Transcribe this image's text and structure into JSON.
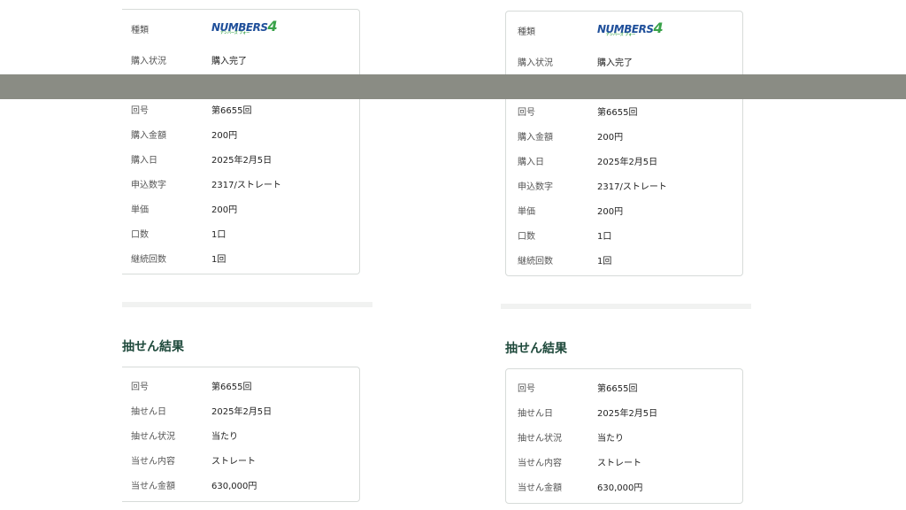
{
  "purchase": {
    "rows": [
      {
        "label": "種類",
        "value": ""
      },
      {
        "label": "購入状況",
        "value": "購入完了"
      },
      {
        "label": "回号",
        "value": "第6655回"
      },
      {
        "label": "購入金額",
        "value": "200円"
      },
      {
        "label": "購入日",
        "value": "2025年2月5日"
      },
      {
        "label": "申込数字",
        "value": "2317/ストレート"
      },
      {
        "label": "単価",
        "value": "200円"
      },
      {
        "label": "口数",
        "value": "1口"
      },
      {
        "label": "継続回数",
        "value": "1回"
      }
    ],
    "logo": {
      "main": "NUMBERS",
      "digit": "4",
      "ruby": "ナンバーズ フォー"
    }
  },
  "result": {
    "title": "抽せん結果",
    "rows": [
      {
        "label": "回号",
        "value": "第6655回"
      },
      {
        "label": "抽せん日",
        "value": "2025年2月5日"
      },
      {
        "label": "抽せん状況",
        "value": "当たり"
      },
      {
        "label": "当せん内容",
        "value": "ストレート"
      },
      {
        "label": "当せん金額",
        "value": "630,000円"
      }
    ]
  },
  "colors": {
    "title": "#1f4a3c",
    "logo_blue": "#1f4f9a",
    "logo_green": "#3aa24a",
    "overlay": "#8a8c84"
  }
}
